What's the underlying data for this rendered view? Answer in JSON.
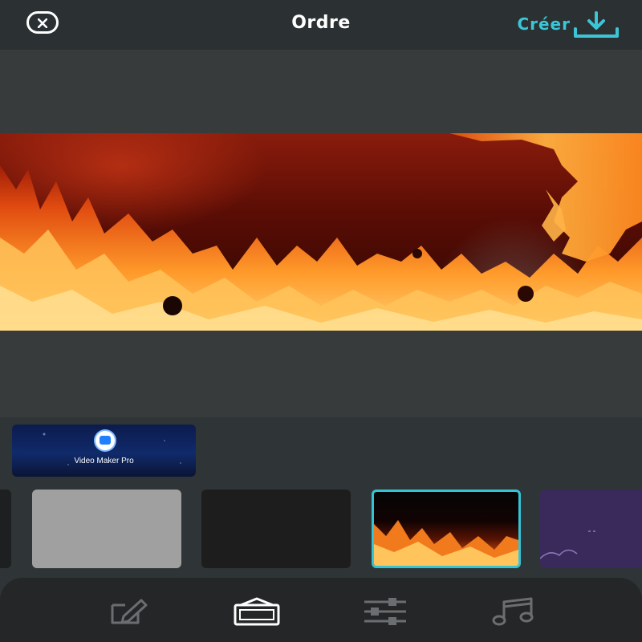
{
  "header": {
    "title": "Ordre",
    "create_label": "Créer"
  },
  "icons": {
    "close": "close-icon",
    "download": "download-icon",
    "edit": "edit-icon",
    "transition": "frame-icon",
    "adjust": "sliders-icon",
    "music": "music-icon"
  },
  "ad": {
    "label": "Video Maker Pro"
  },
  "thumbnails": [
    {
      "style": "partial"
    },
    {
      "style": "gray"
    },
    {
      "style": "dark"
    },
    {
      "style": "fire",
      "selected": true
    },
    {
      "style": "purple"
    }
  ],
  "bottom_nav": {
    "active": "transition"
  },
  "colors": {
    "accent": "#3bc6d8",
    "background": "#2f3436",
    "nav_active": "#ffffff",
    "nav_inactive": "#6b6e70"
  }
}
